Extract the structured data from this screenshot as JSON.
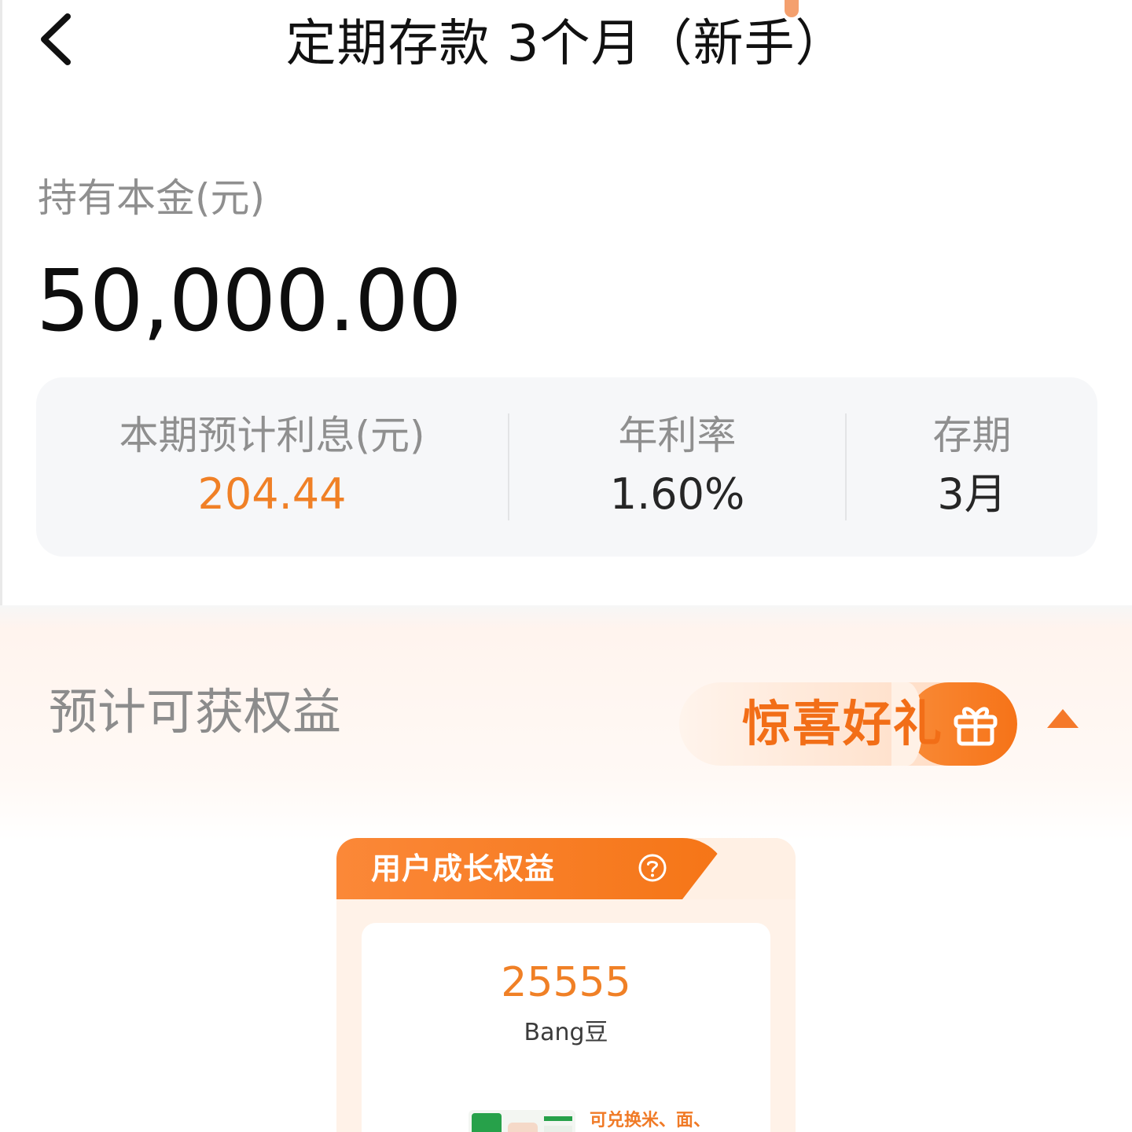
{
  "header": {
    "title": "定期存款 3个月（新手）"
  },
  "principal": {
    "label": "持有本金(元)",
    "value": "50,000.00"
  },
  "stats": {
    "interest_label": "本期预计利息(元)",
    "interest_value": "204.44",
    "rate_label": "年利率",
    "rate_value": "1.60%",
    "term_label": "存期",
    "term_value": "3月"
  },
  "benefits": {
    "title": "预计可获权益",
    "gift_label": "惊喜好礼",
    "growth_card": {
      "title": "用户成长权益",
      "bean_count": "25555",
      "bean_unit": "Bang豆",
      "exchange_note": "可兑换米、面、"
    }
  },
  "colors": {
    "accent": "#f08026",
    "gift_orange": "#f26e17",
    "text_primary": "#111111",
    "text_secondary": "#8f8f8f",
    "card_bg": "#f6f7f9"
  },
  "icons": {
    "back": "chevron-left-icon",
    "gift": "gift-icon",
    "collapse": "triangle-up-icon",
    "help": "question-circle-icon"
  }
}
